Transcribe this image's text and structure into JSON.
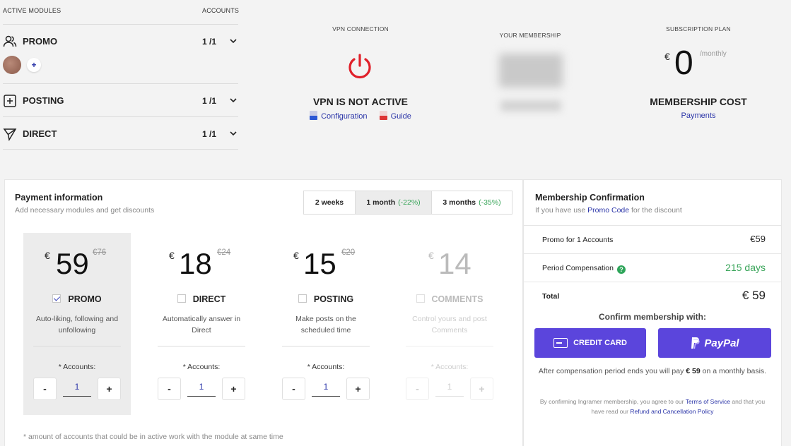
{
  "modules": {
    "header_active": "ACTIVE MODULES",
    "header_accounts": "ACCOUNTS",
    "rows": [
      {
        "name": "PROMO",
        "count": "1 /1"
      },
      {
        "name": "POSTING",
        "count": "1 /1"
      },
      {
        "name": "DIRECT",
        "count": "1 /1"
      }
    ],
    "add_label": "+"
  },
  "vpn": {
    "label": "VPN CONNECTION",
    "status": "VPN IS NOT ACTIVE",
    "config_link": "Configuration",
    "guide_link": "Guide",
    "power_color": "#e0202a"
  },
  "membership": {
    "label": "YOUR MEMBERSHIP"
  },
  "subscription": {
    "label": "SUBSCRIPTION PLAN",
    "currency": "€",
    "value": "0",
    "period": "/monthly",
    "cost_label": "MEMBERSHIP COST",
    "payments_link": "Payments"
  },
  "payment": {
    "title": "Payment information",
    "subtitle": "Add necessary modules and get discounts",
    "periods": [
      {
        "label": "2 weeks",
        "discount": ""
      },
      {
        "label": "1 month",
        "discount": "(-22%)"
      },
      {
        "label": "3 months",
        "discount": "(-35%)"
      }
    ],
    "active_period": 1,
    "modules": [
      {
        "currency": "€",
        "price": "59",
        "old_price": "€76",
        "name": "PROMO",
        "checked": true,
        "desc": "Auto-liking, following and unfollowing",
        "accounts_label": "* Accounts:",
        "accounts": "1",
        "minus": "-",
        "plus": "+"
      },
      {
        "currency": "€",
        "price": "18",
        "old_price": "€24",
        "name": "DIRECT",
        "checked": false,
        "desc": "Automatically answer in Direct",
        "accounts_label": "* Accounts:",
        "accounts": "1",
        "minus": "-",
        "plus": "+"
      },
      {
        "currency": "€",
        "price": "15",
        "old_price": "€20",
        "name": "POSTING",
        "checked": false,
        "desc": "Make posts on the scheduled time",
        "accounts_label": "* Accounts:",
        "accounts": "1",
        "minus": "-",
        "plus": "+"
      },
      {
        "currency": "€",
        "price": "14",
        "old_price": "",
        "name": "COMMENTS",
        "checked": false,
        "desc": "Control yours and post Comments",
        "accounts_label": "* Accounts:",
        "accounts": "1",
        "minus": "-",
        "plus": "+"
      }
    ],
    "footnote": "* amount of accounts that could be in active work with the module at same time"
  },
  "confirmation": {
    "title": "Membership Confirmation",
    "subtitle_pre": "If you have use ",
    "subtitle_link": "Promo Code",
    "subtitle_post": " for the discount",
    "rows": [
      {
        "label": "Promo for 1 Accounts",
        "value": "€59"
      },
      {
        "label": "Period Compensation",
        "value": "215 days"
      },
      {
        "label": "Total",
        "value": "€ 59"
      }
    ],
    "confirm_with": "Confirm membership with:",
    "credit_card": "CREDIT CARD",
    "paypal": "PayPal",
    "after_pre": "After compensation period ends you will pay ",
    "after_amount": "€ 59",
    "after_post": " on a monthly basis.",
    "legal_1": "By confirming Ingramer membership, you agree to our ",
    "legal_tos": "Terms of Service",
    "legal_2": " and that you have read our ",
    "legal_refund": "Refund and Cancellation Policy",
    "accent_color": "#5b45dc"
  }
}
